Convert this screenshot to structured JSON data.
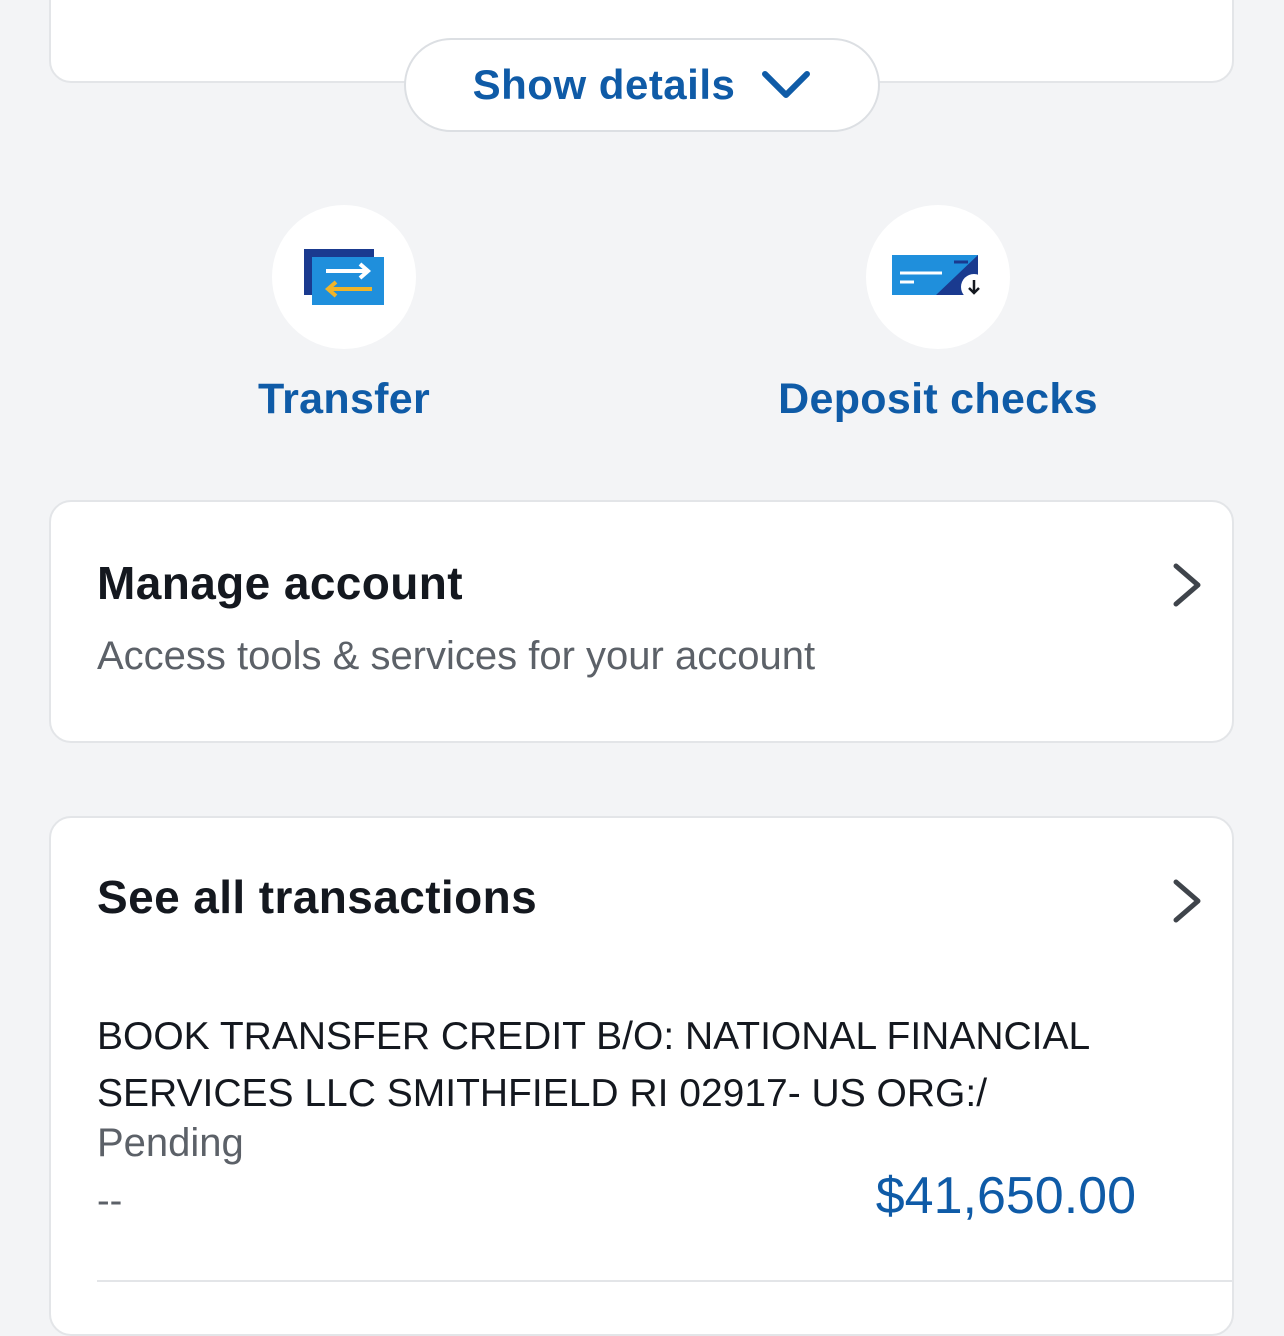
{
  "show_details": {
    "label": "Show details",
    "icon": "chevron-down-icon"
  },
  "actions": [
    {
      "label": "Transfer",
      "icon": "transfer-icon"
    },
    {
      "label": "Deposit checks",
      "icon": "deposit-check-icon"
    }
  ],
  "manage_account": {
    "title": "Manage account",
    "subtitle": "Access tools & services for your account"
  },
  "transactions": {
    "title": "See all transactions",
    "items": [
      {
        "description": "BOOK TRANSFER CREDIT B/O: NATIONAL FINANCIAL SERVICES LLC SMITHFIELD RI 02917- US ORG:/",
        "status": "Pending",
        "date": "--",
        "amount": "$41,650.00"
      }
    ]
  },
  "colors": {
    "accent": "#0f5ba7",
    "background": "#f3f4f6",
    "card": "#ffffff",
    "icon_dark_blue": "#1a3a8f",
    "icon_light_blue": "#1f8fdc",
    "icon_gold": "#f0b429"
  }
}
